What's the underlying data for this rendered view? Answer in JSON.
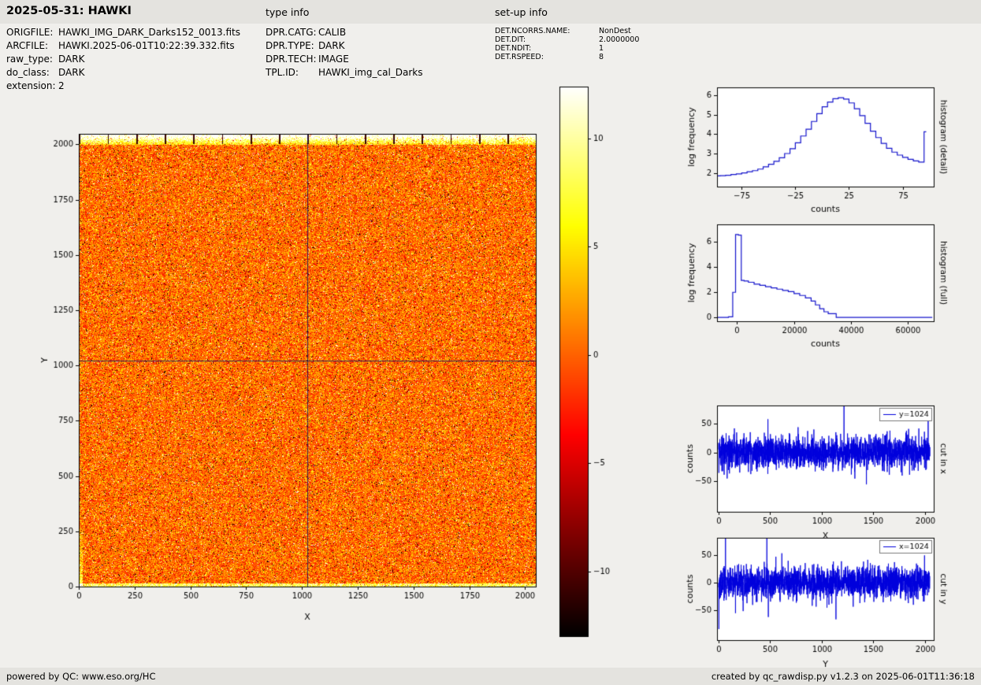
{
  "header": {
    "title": "2025-05-31: HAWKI",
    "type_info_label": "type info",
    "setup_info_label": "set-up info"
  },
  "file_info": {
    "rows": [
      {
        "label": "ORIGFILE:",
        "value": "HAWKI_IMG_DARK_Darks152_0013.fits"
      },
      {
        "label": "ARCFILE:",
        "value": "HAWKI.2025-06-01T10:22:39.332.fits"
      },
      {
        "label": "raw_type:",
        "value": "DARK"
      },
      {
        "label": "do_class:",
        "value": "DARK"
      },
      {
        "label": "extension:",
        "value": "2"
      }
    ]
  },
  "type_info": {
    "rows": [
      {
        "label": "DPR.CATG:",
        "value": "CALIB"
      },
      {
        "label": "DPR.TYPE:",
        "value": "DARK"
      },
      {
        "label": "DPR.TECH:",
        "value": "IMAGE"
      },
      {
        "label": "TPL.ID:",
        "value": "HAWKI_img_cal_Darks"
      }
    ]
  },
  "setup_info": {
    "rows": [
      {
        "label": "DET.NCORRS.NAME:",
        "value": "NonDest"
      },
      {
        "label": "DET.DIT:",
        "value": "2.0000000"
      },
      {
        "label": "DET.NDIT:",
        "value": "1"
      },
      {
        "label": "DET.RSPEED:",
        "value": "8"
      }
    ]
  },
  "footer": {
    "left": "powered by QC: www.eso.org/HC",
    "right": "created by qc_rawdisp.py v1.2.3 on 2025-06-01T11:36:18"
  },
  "chart_data": [
    {
      "id": "main_image",
      "type": "heatmap",
      "xlabel": "X",
      "ylabel": "Y",
      "xlim": [
        0,
        2048
      ],
      "ylim": [
        0,
        2048
      ],
      "xticks": [
        0,
        250,
        500,
        750,
        1000,
        1250,
        1500,
        1750,
        2000
      ],
      "yticks": [
        0,
        250,
        500,
        750,
        1000,
        1250,
        1500,
        1750,
        2000
      ],
      "colormap": "hot",
      "value_range": [
        -13.0,
        12.4
      ],
      "crosshair": {
        "x": 1024,
        "y": 1024,
        "color": "#14145f"
      },
      "noise": {
        "seed": 7,
        "mean": 0,
        "sigma_counts": 2.6,
        "outlier_fraction": 0.06
      },
      "features": {
        "bright_top_rows": 50,
        "bright_bottom_rows": 14,
        "channel_marks": 16
      }
    },
    {
      "id": "colorbar",
      "type": "colorbar",
      "colormap": "hot",
      "vmin": -13.0,
      "vmax": 12.4,
      "ticks": [
        10,
        5,
        0,
        -5,
        -10
      ]
    },
    {
      "id": "hist_detail",
      "type": "line",
      "style": "step",
      "side_label": "histogram (detail)",
      "xlabel": "counts",
      "ylabel": "log frequency",
      "color": "#1414cc",
      "xlim": [
        -98,
        104
      ],
      "ylim": [
        1.3,
        6.4
      ],
      "xticks": [
        -75,
        -25,
        25,
        75
      ],
      "yticks": [
        2,
        3,
        4,
        5,
        6
      ],
      "x": [
        -100,
        -95,
        -90,
        -85,
        -80,
        -75,
        -70,
        -65,
        -60,
        -55,
        -50,
        -45,
        -40,
        -35,
        -30,
        -25,
        -20,
        -15,
        -10,
        -5,
        0,
        5,
        10,
        15,
        20,
        25,
        30,
        35,
        40,
        45,
        50,
        55,
        60,
        65,
        70,
        75,
        80,
        85,
        90,
        95,
        97
      ],
      "y": [
        1.85,
        1.86,
        1.88,
        1.92,
        1.95,
        2.0,
        2.06,
        2.12,
        2.2,
        2.32,
        2.45,
        2.6,
        2.78,
        3.0,
        3.25,
        3.55,
        3.9,
        4.25,
        4.65,
        5.05,
        5.4,
        5.65,
        5.82,
        5.87,
        5.8,
        5.6,
        5.3,
        4.95,
        4.55,
        4.15,
        3.82,
        3.52,
        3.27,
        3.07,
        2.92,
        2.8,
        2.7,
        2.62,
        2.56,
        4.12,
        4.12
      ]
    },
    {
      "id": "hist_full",
      "type": "line",
      "style": "step",
      "side_label": "histogram (full)",
      "xlabel": "counts",
      "ylabel": "log frequency",
      "color": "#1414cc",
      "xlim": [
        -7000,
        69000
      ],
      "ylim": [
        -0.3,
        7.4
      ],
      "xticks": [
        0,
        20000,
        40000,
        60000
      ],
      "yticks": [
        0,
        2,
        4,
        6
      ],
      "x": [
        -7000,
        -3000,
        -1500,
        -500,
        500,
        1500,
        2500,
        4000,
        6000,
        8000,
        10000,
        12000,
        14000,
        16000,
        18000,
        20000,
        22000,
        24000,
        26000,
        27500,
        29000,
        30500,
        32000,
        33800,
        34800,
        68500
      ],
      "y": [
        0,
        0.05,
        2.0,
        6.6,
        6.55,
        2.95,
        2.9,
        2.8,
        2.65,
        2.55,
        2.45,
        2.35,
        2.25,
        2.15,
        2.05,
        1.9,
        1.75,
        1.55,
        1.3,
        1.0,
        0.7,
        0.45,
        0.3,
        0.3,
        0,
        0
      ]
    },
    {
      "id": "cut_x",
      "type": "line",
      "style": "noise",
      "side_label": "cut in x",
      "xlabel": "X",
      "ylabel": "counts",
      "legend": "y=1024",
      "color": "#0000dd",
      "xlim": [
        -15,
        2084
      ],
      "ylim": [
        -104,
        82
      ],
      "xticks": [
        0,
        500,
        1000,
        1500,
        2000
      ],
      "yticks": [
        -50,
        0,
        50
      ],
      "noise": {
        "n": 2048,
        "sigma": 14,
        "seed": 42
      },
      "spikes": [
        {
          "x": 478,
          "v": 58
        },
        {
          "x": 770,
          "v": 44
        },
        {
          "x": 1215,
          "v": 92
        },
        {
          "x": 1320,
          "v": -46
        },
        {
          "x": 1432,
          "v": -56
        },
        {
          "x": 1660,
          "v": 38
        }
      ]
    },
    {
      "id": "cut_y",
      "type": "line",
      "style": "noise",
      "side_label": "cut in y",
      "xlabel": "Y",
      "ylabel": "counts",
      "legend": "x=1024",
      "color": "#0000dd",
      "xlim": [
        -15,
        2084
      ],
      "ylim": [
        -104,
        82
      ],
      "xticks": [
        0,
        500,
        1000,
        1500,
        2000
      ],
      "yticks": [
        -50,
        0,
        50
      ],
      "noise": {
        "n": 2048,
        "sigma": 14,
        "seed": 77
      },
      "spikes": [
        {
          "x": 330,
          "v": -40
        },
        {
          "x": 468,
          "v": 88
        },
        {
          "x": 482,
          "v": -62
        },
        {
          "x": 1050,
          "v": -45
        },
        {
          "x": 1445,
          "v": 42
        },
        {
          "x": 1470,
          "v": 36
        }
      ]
    }
  ]
}
